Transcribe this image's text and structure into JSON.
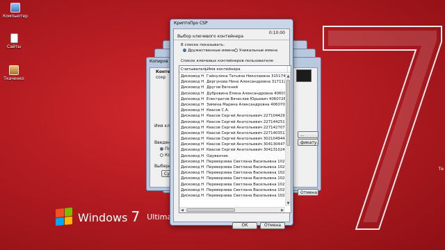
{
  "desktop": {
    "icons": [
      {
        "label": "Компьютер"
      },
      {
        "label": "Сайты"
      },
      {
        "label": "Ткаченко"
      }
    ],
    "brand": {
      "name": "Windows",
      "version": "7",
      "edition": "Ultimate"
    },
    "right_edge_label": "Те"
  },
  "background_windows": {
    "copy_title": "Копиров",
    "partial_title": "Конте",
    "partial_sub": "сохр",
    "key_name_label": "Имя ключевог",
    "entered_label": "Введенно",
    "radio_1": "По",
    "radio_2": "Ко",
    "select_label": "Выберите",
    "crypto_button": "Сург",
    "browse_button": "...",
    "cert_button": "фикату...",
    "cancel_button": "Отмена"
  },
  "dialog": {
    "title": "КриптоПро CSP",
    "timer": "0:10:00",
    "header": "Выбор ключевого контейнера",
    "show_label": "В списке показывать:",
    "options": [
      {
        "label": "Дружественные имена",
        "selected": true
      },
      {
        "label": "Уникальные имена",
        "selected": false
      }
    ],
    "list_label": "Список ключевых контейнеров пользователя:",
    "columns": [
      "Считыватель",
      "Имя контейнера"
    ],
    "rows": [
      [
        "Дисковод H",
        "Гайнулина Татьяна Николаевна 315174256"
      ],
      [
        "Дисковод H",
        "Дергунова Нина Александровна 317112942"
      ],
      [
        "Дисковод H",
        "Другов Евгений"
      ],
      [
        "Дисковод H",
        "Дубровина Елена Александровна 406073349"
      ],
      [
        "Дисковод H",
        "Елистратов Вячеслав Юрьевич 406072659"
      ],
      [
        "Дисковод H",
        "Зимина Марина Александровна 406070929"
      ],
      [
        "Дисковод H",
        "Квасов С.А."
      ],
      [
        "Дисковод H",
        "Квасов Сергей Анатольевич 227104429"
      ],
      [
        "Дисковод H",
        "Квасов Сергей Анатольевич 227144251"
      ],
      [
        "Дисковод H",
        "Квасов Сергей Анатольевич 227142707"
      ],
      [
        "Дисковод H",
        "Квасов Сергей Анатольевич 227140351"
      ],
      [
        "Дисковод H",
        "Квасов Сергей Анатольевич 302104944"
      ],
      [
        "Дисковод H",
        "Квасов Сергей Анатольевич 304130447"
      ],
      [
        "Дисковод H",
        "Квасов Сергей Анатольевич 304131024"
      ],
      [
        "Дисковод H",
        "Одуванчик."
      ],
      [
        "Дисковод H",
        "Переверзева Светлана Васильевна 1029085..."
      ],
      [
        "Дисковод H",
        "Переверзева Светлана Васильевна 1029090..."
      ],
      [
        "Дисковод H",
        "Переверзева Светлана Васильевна 1029092..."
      ],
      [
        "Дисковод H",
        "Переверзева Светлана Васильевна 1029092..."
      ],
      [
        "Дисковод H",
        "Переверзева Светлана Васильевна 1029093..."
      ],
      [
        "Дисковод H",
        "Переверзева Светлана Васильевна 1029095..."
      ],
      [
        "Дисковод H",
        "Переверзева Светлана Васильевна 1029090..."
      ]
    ],
    "ok_button": "ОК",
    "cancel_button": "Отмена"
  },
  "colors": {
    "desktop_red": "#b51c22",
    "flag_red": "#f25022",
    "flag_green": "#7fba00",
    "flag_blue": "#00a4ef",
    "flag_yellow": "#ffb900"
  }
}
